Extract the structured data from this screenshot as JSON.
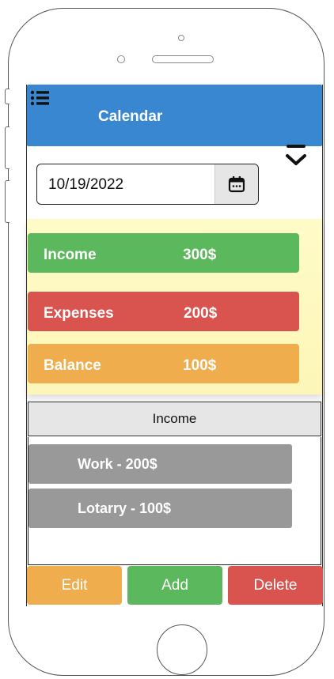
{
  "header": {
    "title": "Calendar",
    "menu_icon": "menu-icon",
    "collapse_icon": "chevron-down-icon"
  },
  "date_picker": {
    "value": "10/19/2022",
    "icon": "calendar-icon"
  },
  "summary": {
    "income": {
      "label": "Income",
      "value": "300$",
      "color": "#5cb85c"
    },
    "expenses": {
      "label": "Expenses",
      "value": "200$",
      "color": "#d9534f"
    },
    "balance": {
      "label": "Balance",
      "value": "100$",
      "color": "#f0ad4e"
    }
  },
  "section": {
    "tab_label": "Income"
  },
  "items": [
    {
      "label": "Work - 200$"
    },
    {
      "label": "Lotarry - 100$"
    }
  ],
  "actions": {
    "edit": "Edit",
    "add": "Add",
    "delete": "Delete"
  }
}
